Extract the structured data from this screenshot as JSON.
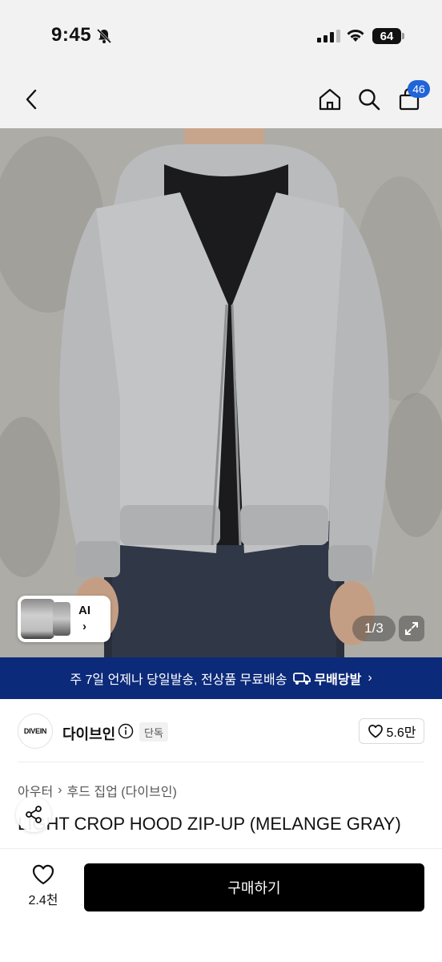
{
  "status_bar": {
    "time": "9:45",
    "battery": "64"
  },
  "nav": {
    "cart_badge": "46"
  },
  "gallery": {
    "counter": "1/3",
    "ai_label": "AI",
    "ai_arrow": "›"
  },
  "banner": {
    "text": "주 7일 언제나 당일발송, 전상품 무료배송",
    "logo_text": "무배당발",
    "arrow": "›"
  },
  "shop": {
    "logo_text": "DIVEIN",
    "name": "다이브인",
    "badge": "단독",
    "likes": "5.6만"
  },
  "breadcrumb": {
    "category": "아우터",
    "separator": "›",
    "subcategory": "후드 집업 (다이브인)"
  },
  "product": {
    "title": "LIGHT CROP HOOD ZIP-UP (MELANGE GRAY)"
  },
  "bottom": {
    "wish_count": "2.4천",
    "buy_label": "구매하기"
  },
  "colors": {
    "accent": "#1f64d8",
    "banner_bg": "#0c2a7a",
    "buy_bg": "#000000"
  }
}
